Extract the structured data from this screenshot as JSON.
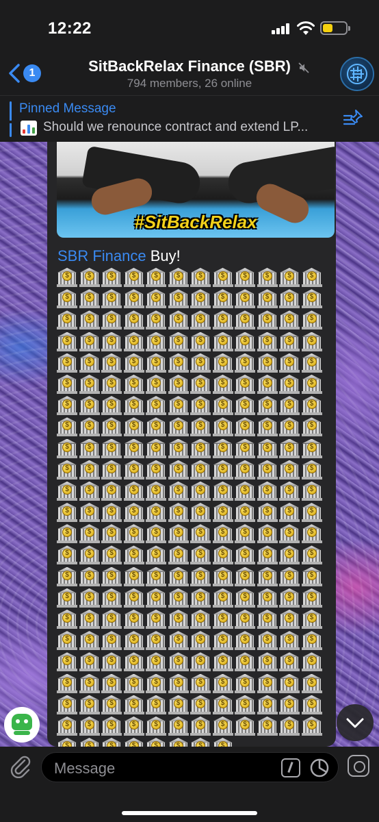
{
  "status_bar": {
    "time": "12:22"
  },
  "header": {
    "back_badge": "1",
    "title": "SitBackRelax Finance (SBR)",
    "subtitle": "794 members, 26 online",
    "muted": true
  },
  "pinned": {
    "title": "Pinned Message",
    "text": "Should we renounce contract and extend LP..."
  },
  "message": {
    "gif_caption": "#SitBackRelax",
    "sender": "SBR Finance",
    "text": "Buy!",
    "emoji_name": "bank-emoji",
    "emoji_coin_symbol": "$",
    "emoji_count": 272,
    "emoji_columns": 12
  },
  "input": {
    "placeholder": "Message"
  },
  "colors": {
    "accent": "#3a8af2",
    "bar_bg": "#1c1c1d",
    "bubble_bg": "#262628",
    "gif_caption": "#f2d11a"
  }
}
